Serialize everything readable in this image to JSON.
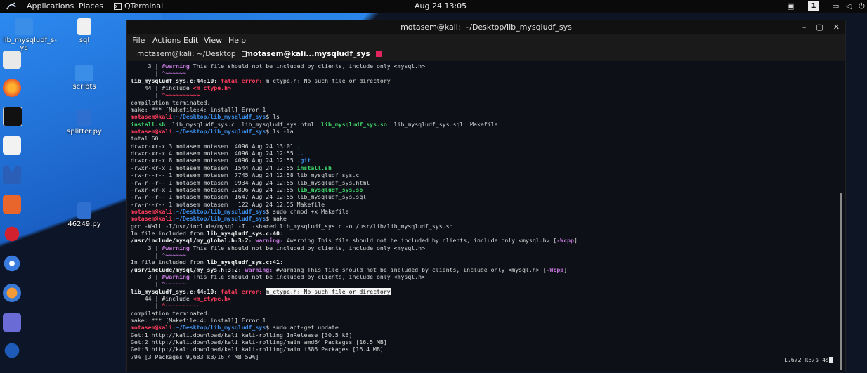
{
  "topbar": {
    "applications": "Applications",
    "places": "Places",
    "app": "QTerminal",
    "clock": "Aug 24  13:05",
    "workspace": "1"
  },
  "desktop_icons": [
    {
      "name": "lib_mysqludf_s-ys",
      "icon": "folder-icon"
    },
    {
      "name": "sql",
      "icon": "file-icon"
    },
    {
      "name": "scripts",
      "icon": "folder-icon"
    },
    {
      "name": "splitter.py",
      "icon": "python-icon"
    },
    {
      "name": "46249.py",
      "icon": "python-icon"
    }
  ],
  "window": {
    "title": "motasem@kali: ~/Desktop/lib_mysqludf_sys",
    "menu": [
      "File",
      "Actions",
      "Edit",
      "View",
      "Help"
    ],
    "tabs": [
      "motasem@kali: ~/Desktop",
      "motasem@kali...mysqludf_sys"
    ],
    "speed": "1,672 kB/s 4s"
  },
  "terminal": [
    [
      {
        "t": "     3 | "
      },
      {
        "t": "#warning",
        "c": "purple"
      },
      {
        "t": " This file should not be included by clients, include only <mysql.h>"
      }
    ],
    [
      {
        "t": "       | "
      },
      {
        "t": "^~~~~~~",
        "c": "purple"
      }
    ],
    [
      {
        "t": "lib_mysqludf_sys.c:44:10: ",
        "c": "bold"
      },
      {
        "t": "fatal error: ",
        "c": "red"
      },
      {
        "t": "m_ctype.h: No such file or directory"
      }
    ],
    [
      {
        "t": "    44 | #include "
      },
      {
        "t": "<m_ctype.h>",
        "c": "red"
      }
    ],
    [
      {
        "t": "       | "
      },
      {
        "t": "^~~~~~~~~~~",
        "c": "red"
      }
    ],
    [
      {
        "t": "compilation terminated."
      }
    ],
    [
      {
        "t": "make: *** [Makefile:4: install] Error 1"
      }
    ],
    [
      {
        "t": "motasem@kali",
        "c": "red"
      },
      {
        "t": ":~/Desktop/lib_mysqludf_sys",
        "c": "blue"
      },
      {
        "t": "$ ls"
      }
    ],
    [
      {
        "t": "install.sh",
        "c": "green"
      },
      {
        "t": "  lib_mysqludf_sys.c  lib_mysqludf_sys.html  "
      },
      {
        "t": "lib_mysqludf_sys.so",
        "c": "green"
      },
      {
        "t": "  lib_mysqludf_sys.sql  Makefile"
      }
    ],
    [
      {
        "t": "motasem@kali",
        "c": "red"
      },
      {
        "t": ":~/Desktop/lib_mysqludf_sys",
        "c": "blue"
      },
      {
        "t": "$ ls -la"
      }
    ],
    [
      {
        "t": "total 60"
      }
    ],
    [
      {
        "t": "drwxr-xr-x 3 motasem motasem  4096 Aug 24 13:01 "
      },
      {
        "t": ".",
        "c": "blue"
      }
    ],
    [
      {
        "t": "drwxr-xr-x 4 motasem motasem  4096 Aug 24 12:55 "
      },
      {
        "t": "..",
        "c": "blue"
      }
    ],
    [
      {
        "t": "drwxr-xr-x 8 motasem motasem  4096 Aug 24 12:55 "
      },
      {
        "t": ".git",
        "c": "blue"
      }
    ],
    [
      {
        "t": "-rwxr-xr-x 1 motasem motasem  1544 Aug 24 12:55 "
      },
      {
        "t": "install.sh",
        "c": "green"
      }
    ],
    [
      {
        "t": "-rw-r--r-- 1 motasem motasem  7745 Aug 24 12:58 lib_mysqludf_sys.c"
      }
    ],
    [
      {
        "t": "-rw-r--r-- 1 motasem motasem  9934 Aug 24 12:55 lib_mysqludf_sys.html"
      }
    ],
    [
      {
        "t": "-rwxr-xr-x 1 motasem motasem 12896 Aug 24 12:55 "
      },
      {
        "t": "lib_mysqludf_sys.so",
        "c": "green"
      }
    ],
    [
      {
        "t": "-rw-r--r-- 1 motasem motasem  1647 Aug 24 12:55 lib_mysqludf_sys.sql"
      }
    ],
    [
      {
        "t": "-rw-r--r-- 1 motasem motasem   122 Aug 24 12:55 Makefile"
      }
    ],
    [
      {
        "t": "motasem@kali",
        "c": "red"
      },
      {
        "t": ":~/Desktop/lib_mysqludf_sys",
        "c": "blue"
      },
      {
        "t": "$ sudo chmod +x Makefile"
      }
    ],
    [
      {
        "t": "motasem@kali",
        "c": "red"
      },
      {
        "t": ":~/Desktop/lib_mysqludf_sys",
        "c": "blue"
      },
      {
        "t": "$ make"
      }
    ],
    [
      {
        "t": "gcc -Wall -I/usr/include/mysql -I. -shared lib_mysqludf_sys.c -o /usr/lib/lib_mysqludf_sys.so"
      }
    ],
    [
      {
        "t": "In file included from "
      },
      {
        "t": "lib_mysqludf_sys.c:40",
        "c": "bold"
      },
      {
        "t": ":"
      }
    ],
    [
      {
        "t": "/usr/include/mysql/my_global.h:3:2: ",
        "c": "bold"
      },
      {
        "t": "warning: ",
        "c": "purple"
      },
      {
        "t": "#warning This file should not be included by clients, include only <mysql.h> ["
      },
      {
        "t": "-Wcpp",
        "c": "purple"
      },
      {
        "t": "]"
      }
    ],
    [
      {
        "t": "     3 | "
      },
      {
        "t": "#warning",
        "c": "purple"
      },
      {
        "t": " This file should not be included by clients, include only <mysql.h>"
      }
    ],
    [
      {
        "t": "       | "
      },
      {
        "t": "^~~~~~~",
        "c": "purple"
      }
    ],
    [
      {
        "t": "In file included from "
      },
      {
        "t": "lib_mysqludf_sys.c:41",
        "c": "bold"
      },
      {
        "t": ":"
      }
    ],
    [
      {
        "t": "/usr/include/mysql/my_sys.h:3:2: ",
        "c": "bold"
      },
      {
        "t": "warning: ",
        "c": "purple"
      },
      {
        "t": "#warning This file should not be included by clients, include only <mysql.h> ["
      },
      {
        "t": "-Wcpp",
        "c": "purple"
      },
      {
        "t": "]"
      }
    ],
    [
      {
        "t": "     3 | "
      },
      {
        "t": "#warning",
        "c": "purple"
      },
      {
        "t": " This file should not be included by clients, include only <mysql.h>"
      }
    ],
    [
      {
        "t": "       | "
      },
      {
        "t": "^~~~~~~",
        "c": "purple"
      }
    ],
    [
      {
        "t": "lib_mysqludf_sys.c:44:10: ",
        "c": "bold"
      },
      {
        "t": "fatal error: ",
        "c": "red"
      },
      {
        "t": "m_ctype.h: No such file or directory",
        "c": "hl"
      }
    ],
    [
      {
        "t": "    44 | #include "
      },
      {
        "t": "<m_ctype.h>",
        "c": "red"
      }
    ],
    [
      {
        "t": "       | "
      },
      {
        "t": "^~~~~~~~~~~",
        "c": "red"
      }
    ],
    [
      {
        "t": "compilation terminated."
      }
    ],
    [
      {
        "t": "make: *** [Makefile:4: install] Error 1"
      }
    ],
    [
      {
        "t": "motasem@kali",
        "c": "red"
      },
      {
        "t": ":~/Desktop/lib_mysqludf_sys",
        "c": "blue"
      },
      {
        "t": "$ sudo apt-get update"
      }
    ],
    [
      {
        "t": "Get:1 http://kali.download/kali kali-rolling InRelease [30.5 kB]"
      }
    ],
    [
      {
        "t": "Get:2 http://kali.download/kali kali-rolling/main amd64 Packages [16.5 MB]"
      }
    ],
    [
      {
        "t": "Get:3 http://kali.download/kali kali-rolling/main i386 Packages [16.4 MB]"
      }
    ],
    [
      {
        "t": "79% [3 Packages 9,683 kB/16.4 MB 59%]"
      }
    ]
  ]
}
